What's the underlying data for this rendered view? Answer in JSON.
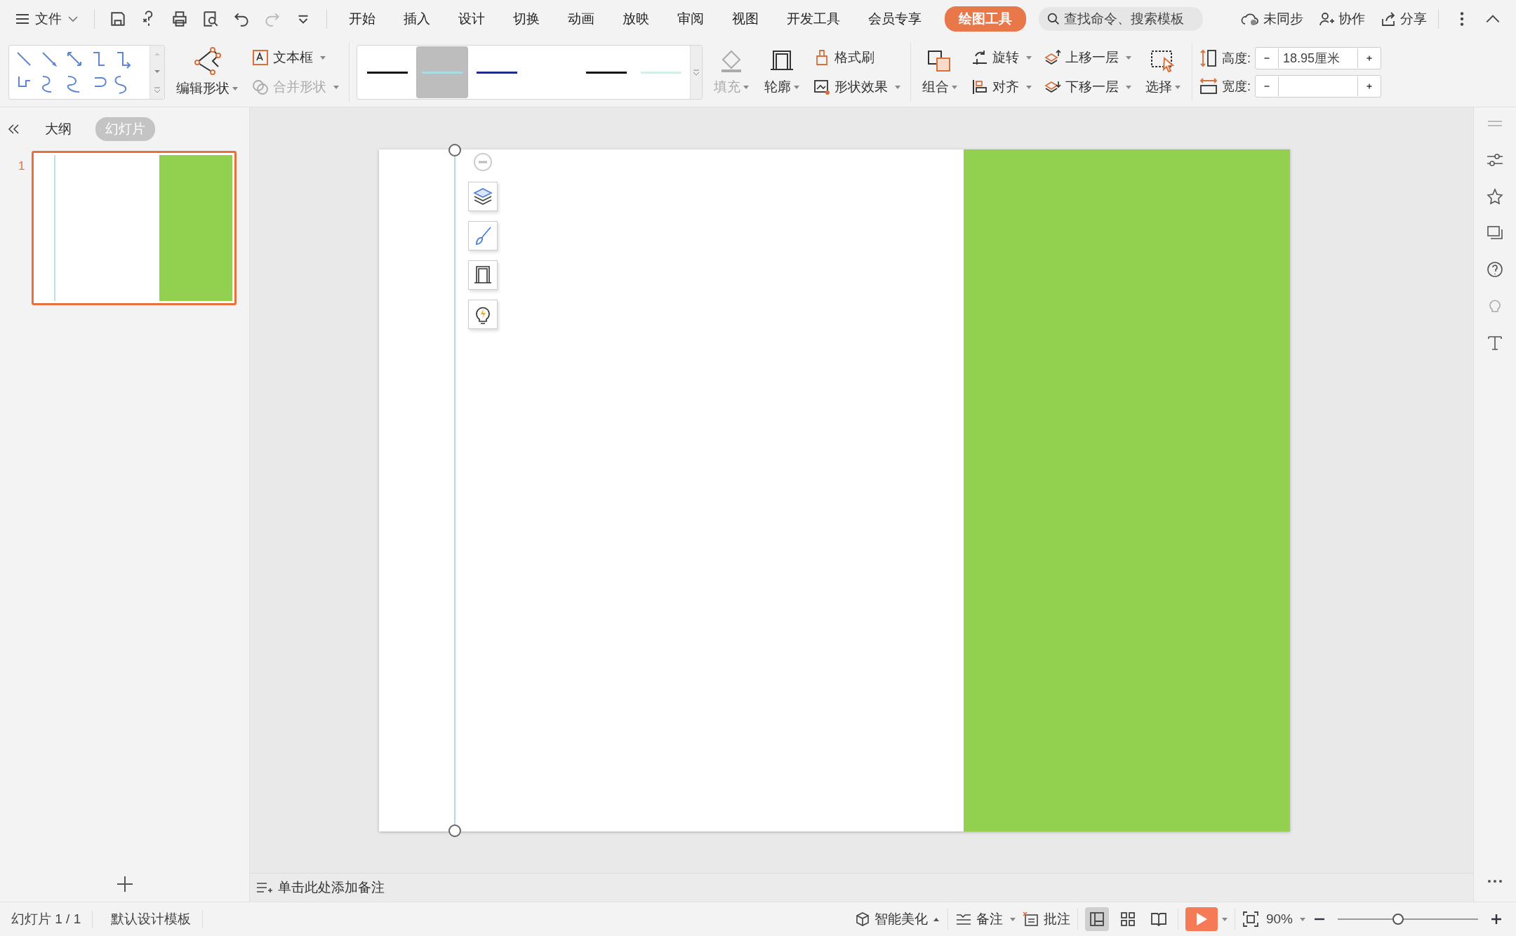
{
  "menu_bar": {
    "file_menu": "文件",
    "tabs": [
      {
        "label": "开始",
        "selected": false
      },
      {
        "label": "插入",
        "selected": false
      },
      {
        "label": "设计",
        "selected": false
      },
      {
        "label": "切换",
        "selected": false
      },
      {
        "label": "动画",
        "selected": false
      },
      {
        "label": "放映",
        "selected": false
      },
      {
        "label": "审阅",
        "selected": false
      },
      {
        "label": "视图",
        "selected": false
      },
      {
        "label": "开发工具",
        "selected": false
      },
      {
        "label": "会员专享",
        "selected": false
      },
      {
        "label": "绘图工具",
        "selected": true
      }
    ],
    "search": {
      "placeholder": "查找命令、搜索模板"
    },
    "sync": "未同步",
    "collaborate": "协作",
    "share": "分享"
  },
  "ribbon": {
    "edit_shape": "编辑形状",
    "text_box": "文本框",
    "merge_shapes": {
      "label": "合并形状",
      "disabled": true
    },
    "line_styles": [
      {
        "color": "#111111",
        "selected": false
      },
      {
        "color": "#a9dce3",
        "selected": true
      },
      {
        "color": "#1f2a8c",
        "selected": false
      },
      {
        "kind": "blank"
      },
      {
        "color": "#111111",
        "selected": false
      },
      {
        "color": "#d4eeea",
        "selected": false
      }
    ],
    "fill": {
      "label": "填充",
      "disabled": true
    },
    "outline": {
      "label": "轮廓",
      "disabled": false
    },
    "format_painter": "格式刷",
    "shape_effects": "形状效果",
    "group": "组合",
    "rotate": "旋转",
    "align": "对齐",
    "bring_forward": "上移一层",
    "send_backward": "下移一层",
    "select": "选择",
    "height": {
      "label": "高度:",
      "value": "18.95厘米"
    },
    "width": {
      "label": "宽度:"
    }
  },
  "slide_panel": {
    "tabs": [
      {
        "label": "大纲",
        "selected": false
      },
      {
        "label": "幻灯片",
        "selected": true
      }
    ],
    "slides": [
      {
        "number": "1",
        "selected": true
      }
    ]
  },
  "notes": {
    "placeholder": "单击此处添加备注"
  },
  "status_bar": {
    "slide_count": "幻灯片 1 / 1",
    "template": "默认设计模板",
    "beautify": "智能美化",
    "notes": "备注",
    "comments": "批注",
    "views": [
      {
        "selected": true
      },
      {
        "selected": false
      },
      {
        "selected": false
      }
    ],
    "zoom": "90%",
    "zoom_slider": {
      "level": 0.43
    }
  }
}
